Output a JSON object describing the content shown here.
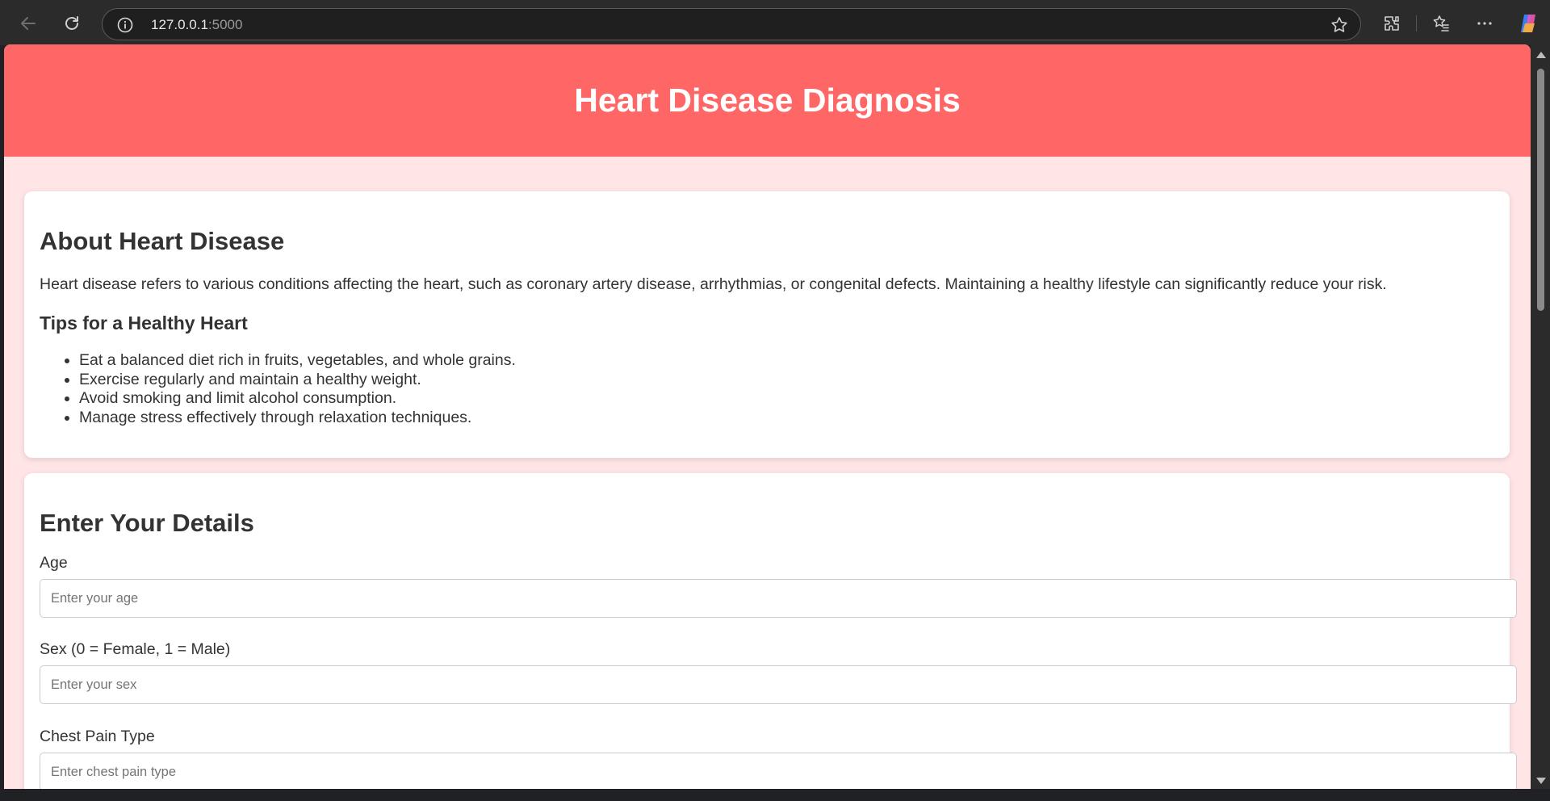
{
  "browser": {
    "url_host": "127.0.0.1",
    "url_port": ":5000"
  },
  "header": {
    "title": "Heart Disease Diagnosis"
  },
  "about": {
    "heading": "About Heart Disease",
    "description": "Heart disease refers to various conditions affecting the heart, such as coronary artery disease, arrhythmias, or congenital defects. Maintaining a healthy lifestyle can significantly reduce your risk.",
    "tips_heading": "Tips for a Healthy Heart",
    "tips": [
      "Eat a balanced diet rich in fruits, vegetables, and whole grains.",
      "Exercise regularly and maintain a healthy weight.",
      "Avoid smoking and limit alcohol consumption.",
      "Manage stress effectively through relaxation techniques."
    ]
  },
  "form": {
    "heading": "Enter Your Details",
    "fields": [
      {
        "label": "Age",
        "placeholder": "Enter your age",
        "value": ""
      },
      {
        "label": "Sex (0 = Female, 1 = Male)",
        "placeholder": "Enter your sex",
        "value": ""
      },
      {
        "label": "Chest Pain Type",
        "placeholder": "Enter chest pain type",
        "value": ""
      }
    ]
  },
  "colors": {
    "header_bg": "#ff6666",
    "page_bg": "#ffe5e5",
    "card_bg": "#ffffff",
    "text": "#333333"
  },
  "icons": [
    "back-arrow-icon",
    "refresh-icon",
    "info-icon",
    "star-icon",
    "extensions-icon",
    "favorites-icon",
    "more-icon",
    "copilot-icon"
  ]
}
